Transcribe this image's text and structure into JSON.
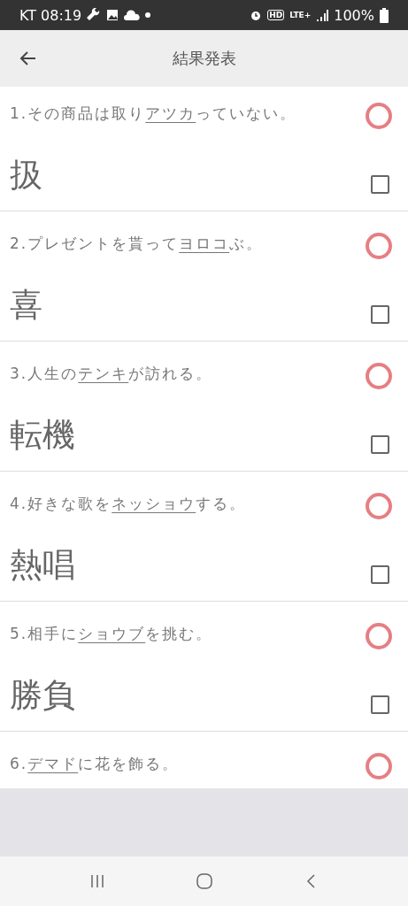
{
  "status_bar": {
    "time": "KT 08:19",
    "network": "HD",
    "lte": "LTE+",
    "battery": "100%"
  },
  "header": {
    "title": "結果発表"
  },
  "items": [
    {
      "before": "1.その商品は取り",
      "underlined": "アツカ",
      "after": "っていない。",
      "answer": "扱",
      "checked": false
    },
    {
      "before": "2.プレゼントを貰って",
      "underlined": "ヨロコ",
      "after": "ぶ。",
      "answer": "喜",
      "checked": false
    },
    {
      "before": "3.人生の",
      "underlined": "テンキ",
      "after": "が訪れる。",
      "answer": "転機",
      "checked": false
    },
    {
      "before": "4.好きな歌を",
      "underlined": "ネッショウ",
      "after": "する。",
      "answer": "熱唱",
      "checked": false
    },
    {
      "before": "5.相手に",
      "underlined": "ショウブ",
      "after": "を挑む。",
      "answer": "勝負",
      "checked": false
    },
    {
      "before": "6.",
      "underlined": "デマド",
      "after": "に花を飾る。"
    }
  ]
}
